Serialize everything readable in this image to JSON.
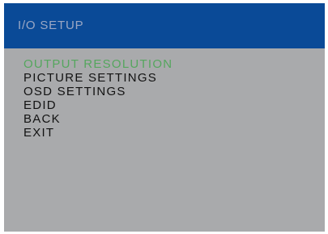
{
  "osd": {
    "title": "I/O SETUP",
    "selected_index": 0,
    "colors": {
      "header_background": "#0a4a97",
      "title_text": "#9aa7c4",
      "panel_background": "#a9aaac",
      "item_text": "#121212",
      "selected_item_text": "#55a65e"
    },
    "menu": [
      {
        "label": "OUTPUT RESOLUTION"
      },
      {
        "label": "PICTURE SETTINGS"
      },
      {
        "label": "OSD SETTINGS"
      },
      {
        "label": "EDID"
      },
      {
        "label": "BACK"
      },
      {
        "label": "EXIT"
      }
    ]
  }
}
